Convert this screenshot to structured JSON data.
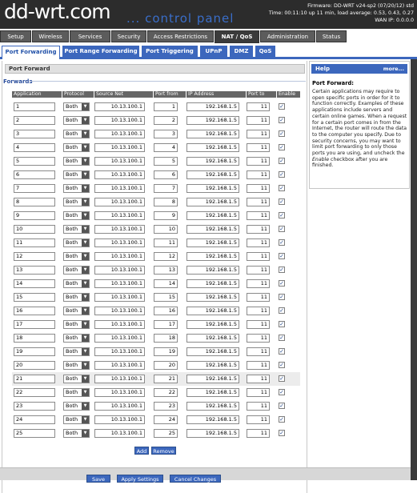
{
  "header": {
    "logo_main": "dd-wrt.com",
    "logo_sub": "... control panel",
    "firmware": "Firmware: DD-WRT v24-sp2 (07/20/12) std",
    "time": "Time: 00:11:10 up 11 min, load average: 0.53, 0.43, 0.27",
    "wan_ip": "WAN IP: 0.0.0.0"
  },
  "nav_main": [
    "Setup",
    "Wireless",
    "Services",
    "Security",
    "Access Restrictions",
    "NAT / QoS",
    "Administration",
    "Status"
  ],
  "nav_main_active": "NAT / QoS",
  "nav_sub": [
    "Port Forwarding",
    "Port Range Forwarding",
    "Port Triggering",
    "UPnP",
    "DMZ",
    "QoS"
  ],
  "nav_sub_active": "Port Forwarding",
  "section_title": "Port Forward",
  "forwards_label": "Forwards",
  "columns": [
    "Application",
    "Protocol",
    "Source Net",
    "Port from",
    "IP Address",
    "Port to",
    "Enable"
  ],
  "rows": [
    {
      "app": "1",
      "protocol": "Both",
      "source": "10.13.100.1",
      "from": "1",
      "ip": "192.168.1.5",
      "to": "11",
      "enabled": true
    },
    {
      "app": "2",
      "protocol": "Both",
      "source": "10.13.100.1",
      "from": "2",
      "ip": "192.168.1.5",
      "to": "11",
      "enabled": true
    },
    {
      "app": "3",
      "protocol": "Both",
      "source": "10.13.100.1",
      "from": "3",
      "ip": "192.168.1.5",
      "to": "11",
      "enabled": true
    },
    {
      "app": "4",
      "protocol": "Both",
      "source": "10.13.100.1",
      "from": "4",
      "ip": "192.168.1.5",
      "to": "11",
      "enabled": true
    },
    {
      "app": "5",
      "protocol": "Both",
      "source": "10.13.100.1",
      "from": "5",
      "ip": "192.168.1.5",
      "to": "11",
      "enabled": true
    },
    {
      "app": "6",
      "protocol": "Both",
      "source": "10.13.100.1",
      "from": "6",
      "ip": "192.168.1.5",
      "to": "11",
      "enabled": true
    },
    {
      "app": "7",
      "protocol": "Both",
      "source": "10.13.100.1",
      "from": "7",
      "ip": "192.168.1.5",
      "to": "11",
      "enabled": true
    },
    {
      "app": "8",
      "protocol": "Both",
      "source": "10.13.100.1",
      "from": "8",
      "ip": "192.168.1.5",
      "to": "11",
      "enabled": true
    },
    {
      "app": "9",
      "protocol": "Both",
      "source": "10.13.100.1",
      "from": "9",
      "ip": "192.168.1.5",
      "to": "11",
      "enabled": true
    },
    {
      "app": "10",
      "protocol": "Both",
      "source": "10.13.100.1",
      "from": "10",
      "ip": "192.168.1.5",
      "to": "11",
      "enabled": true
    },
    {
      "app": "11",
      "protocol": "Both",
      "source": "10.13.100.1",
      "from": "11",
      "ip": "192.168.1.5",
      "to": "11",
      "enabled": true
    },
    {
      "app": "12",
      "protocol": "Both",
      "source": "10.13.100.1",
      "from": "12",
      "ip": "192.168.1.5",
      "to": "11",
      "enabled": true
    },
    {
      "app": "13",
      "protocol": "Both",
      "source": "10.13.100.1",
      "from": "13",
      "ip": "192.168.1.5",
      "to": "11",
      "enabled": true
    },
    {
      "app": "14",
      "protocol": "Both",
      "source": "10.13.100.1",
      "from": "14",
      "ip": "192.168.1.5",
      "to": "11",
      "enabled": true
    },
    {
      "app": "15",
      "protocol": "Both",
      "source": "10.13.100.1",
      "from": "15",
      "ip": "192.168.1.5",
      "to": "11",
      "enabled": true
    },
    {
      "app": "16",
      "protocol": "Both",
      "source": "10.13.100.1",
      "from": "16",
      "ip": "192.168.1.5",
      "to": "11",
      "enabled": true
    },
    {
      "app": "17",
      "protocol": "Both",
      "source": "10.13.100.1",
      "from": "17",
      "ip": "192.168.1.5",
      "to": "11",
      "enabled": true
    },
    {
      "app": "18",
      "protocol": "Both",
      "source": "10.13.100.1",
      "from": "18",
      "ip": "192.168.1.5",
      "to": "11",
      "enabled": true
    },
    {
      "app": "19",
      "protocol": "Both",
      "source": "10.13.100.1",
      "from": "19",
      "ip": "192.168.1.5",
      "to": "11",
      "enabled": true
    },
    {
      "app": "20",
      "protocol": "Both",
      "source": "10.13.100.1",
      "from": "20",
      "ip": "192.168.1.5",
      "to": "11",
      "enabled": true
    },
    {
      "app": "21",
      "protocol": "Both",
      "source": "10.13.100.1",
      "from": "21",
      "ip": "192.168.1.5",
      "to": "11",
      "enabled": true
    },
    {
      "app": "22",
      "protocol": "Both",
      "source": "10.13.100.1",
      "from": "22",
      "ip": "192.168.1.5",
      "to": "11",
      "enabled": true
    },
    {
      "app": "23",
      "protocol": "Both",
      "source": "10.13.100.1",
      "from": "23",
      "ip": "192.168.1.5",
      "to": "11",
      "enabled": true
    },
    {
      "app": "24",
      "protocol": "Both",
      "source": "10.13.100.1",
      "from": "24",
      "ip": "192.168.1.5",
      "to": "11",
      "enabled": true
    },
    {
      "app": "25",
      "protocol": "Both",
      "source": "10.13.100.1",
      "from": "25",
      "ip": "192.168.1.5",
      "to": "11",
      "enabled": true
    }
  ],
  "highlighted_row": "21",
  "buttons": {
    "add": "Add",
    "remove": "Remove",
    "save": "Save",
    "apply": "Apply Settings",
    "cancel": "Cancel Changes"
  },
  "help": {
    "title": "Help",
    "more": "more...",
    "heading": "Port Forward:",
    "text_before": "Certain applications may require to open specific ports in order for it to function correctly. Examples of these applications include servers and certain online games. When a request for a certain port comes in from the Internet, the router will route the data to the computer you specify. Due to security concerns, you may want to limit port forwarding to only those ports you are using, and uncheck the ",
    "text_em": "Enable",
    "text_after": " checkbox after you are finished."
  },
  "colors": {
    "accent": "#3c67bd",
    "header_bg": "#2c2c2c",
    "tab_bg": "#5c5c5c"
  },
  "icons": {
    "dropdown": "chevron-down-icon",
    "checkbox": "checkmark-icon"
  }
}
